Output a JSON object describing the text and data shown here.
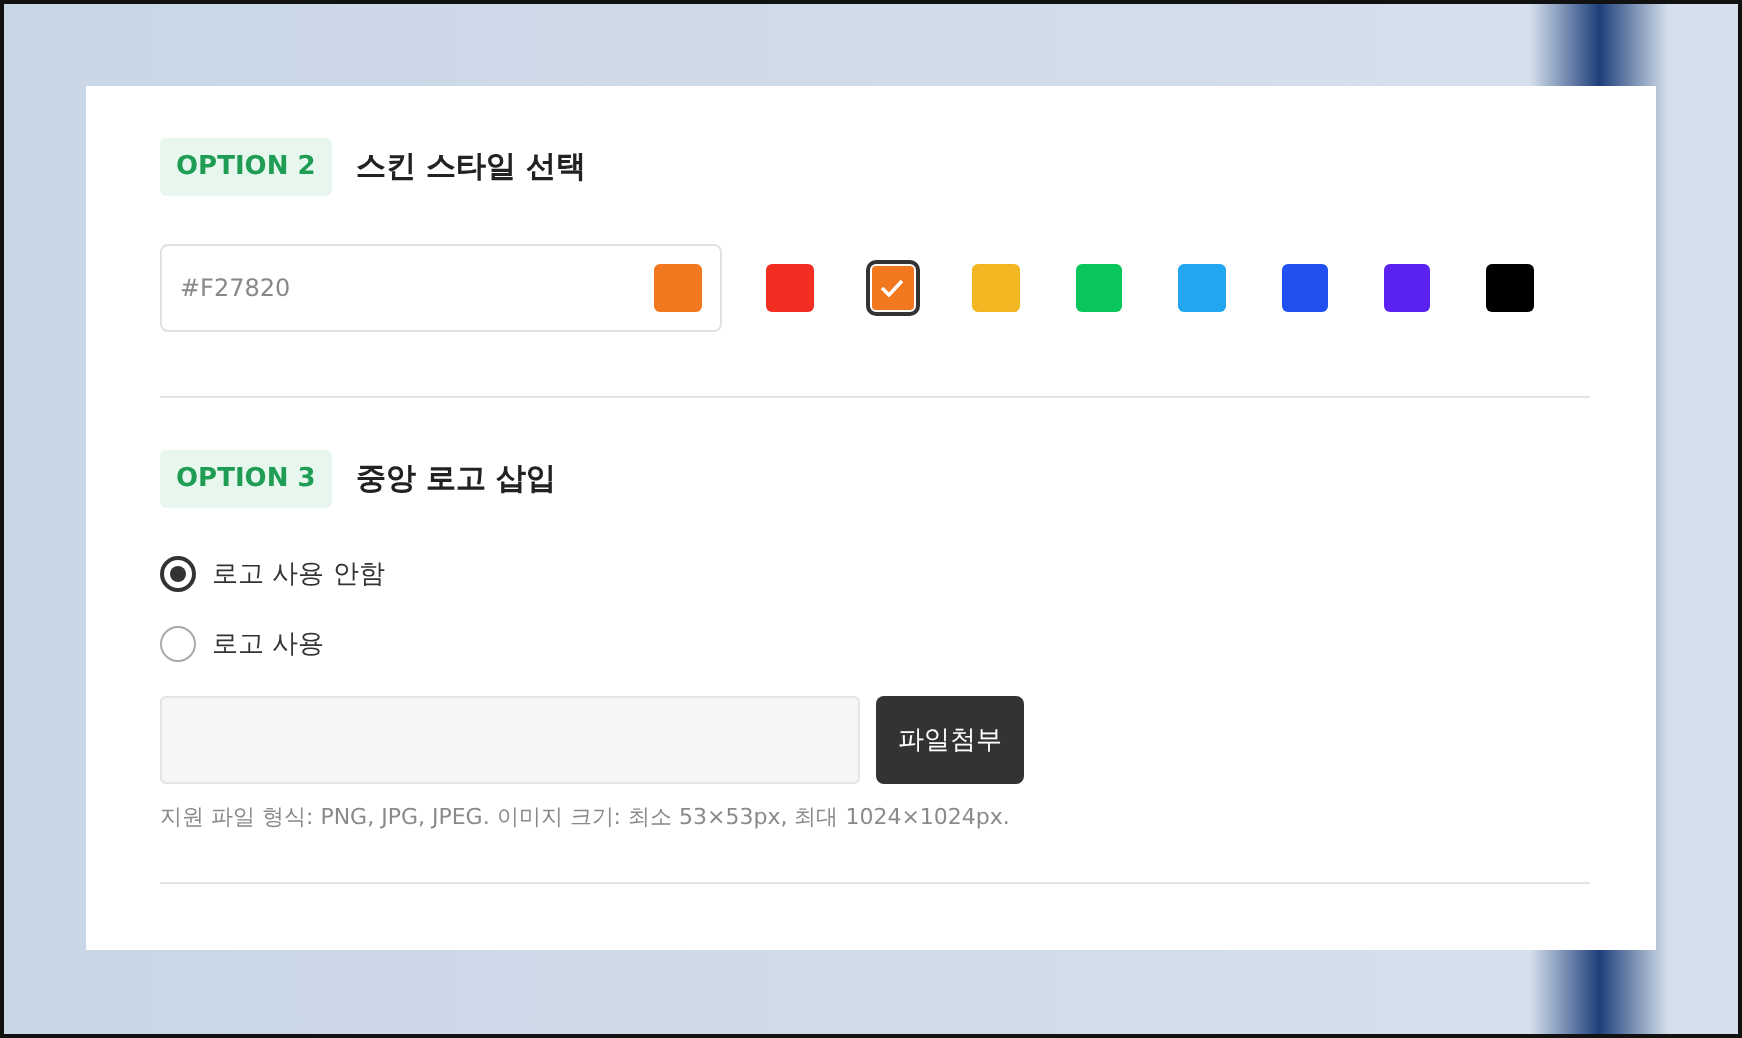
{
  "sections": [
    {
      "kind": "color",
      "badge": "OPTION 2",
      "title": "스킨 스타일 선택",
      "color_field": {
        "value": "#F27820",
        "color": "#f27820"
      },
      "swatches": [
        {
          "color": "#f22e22",
          "selected": false
        },
        {
          "color": "#f27820",
          "selected": true
        },
        {
          "color": "#f2b622",
          "selected": false
        },
        {
          "color": "#0ac65a",
          "selected": false
        },
        {
          "color": "#22a6f0",
          "selected": false
        },
        {
          "color": "#2050f0",
          "selected": false
        },
        {
          "color": "#5a22f0",
          "selected": false
        },
        {
          "color": "#000000",
          "selected": false
        }
      ]
    },
    {
      "kind": "logo",
      "badge": "OPTION 3",
      "title": "중앙 로고 삽입",
      "radios": [
        {
          "label": "로고 사용 안함",
          "selected": true
        },
        {
          "label": "로고 사용",
          "selected": false
        }
      ],
      "upload_button": "파일첨부",
      "hint": "지원 파일 형식: PNG, JPG, JPEG. 이미지 크기: 최소 53×53px, 최대 1024×1024px."
    }
  ]
}
